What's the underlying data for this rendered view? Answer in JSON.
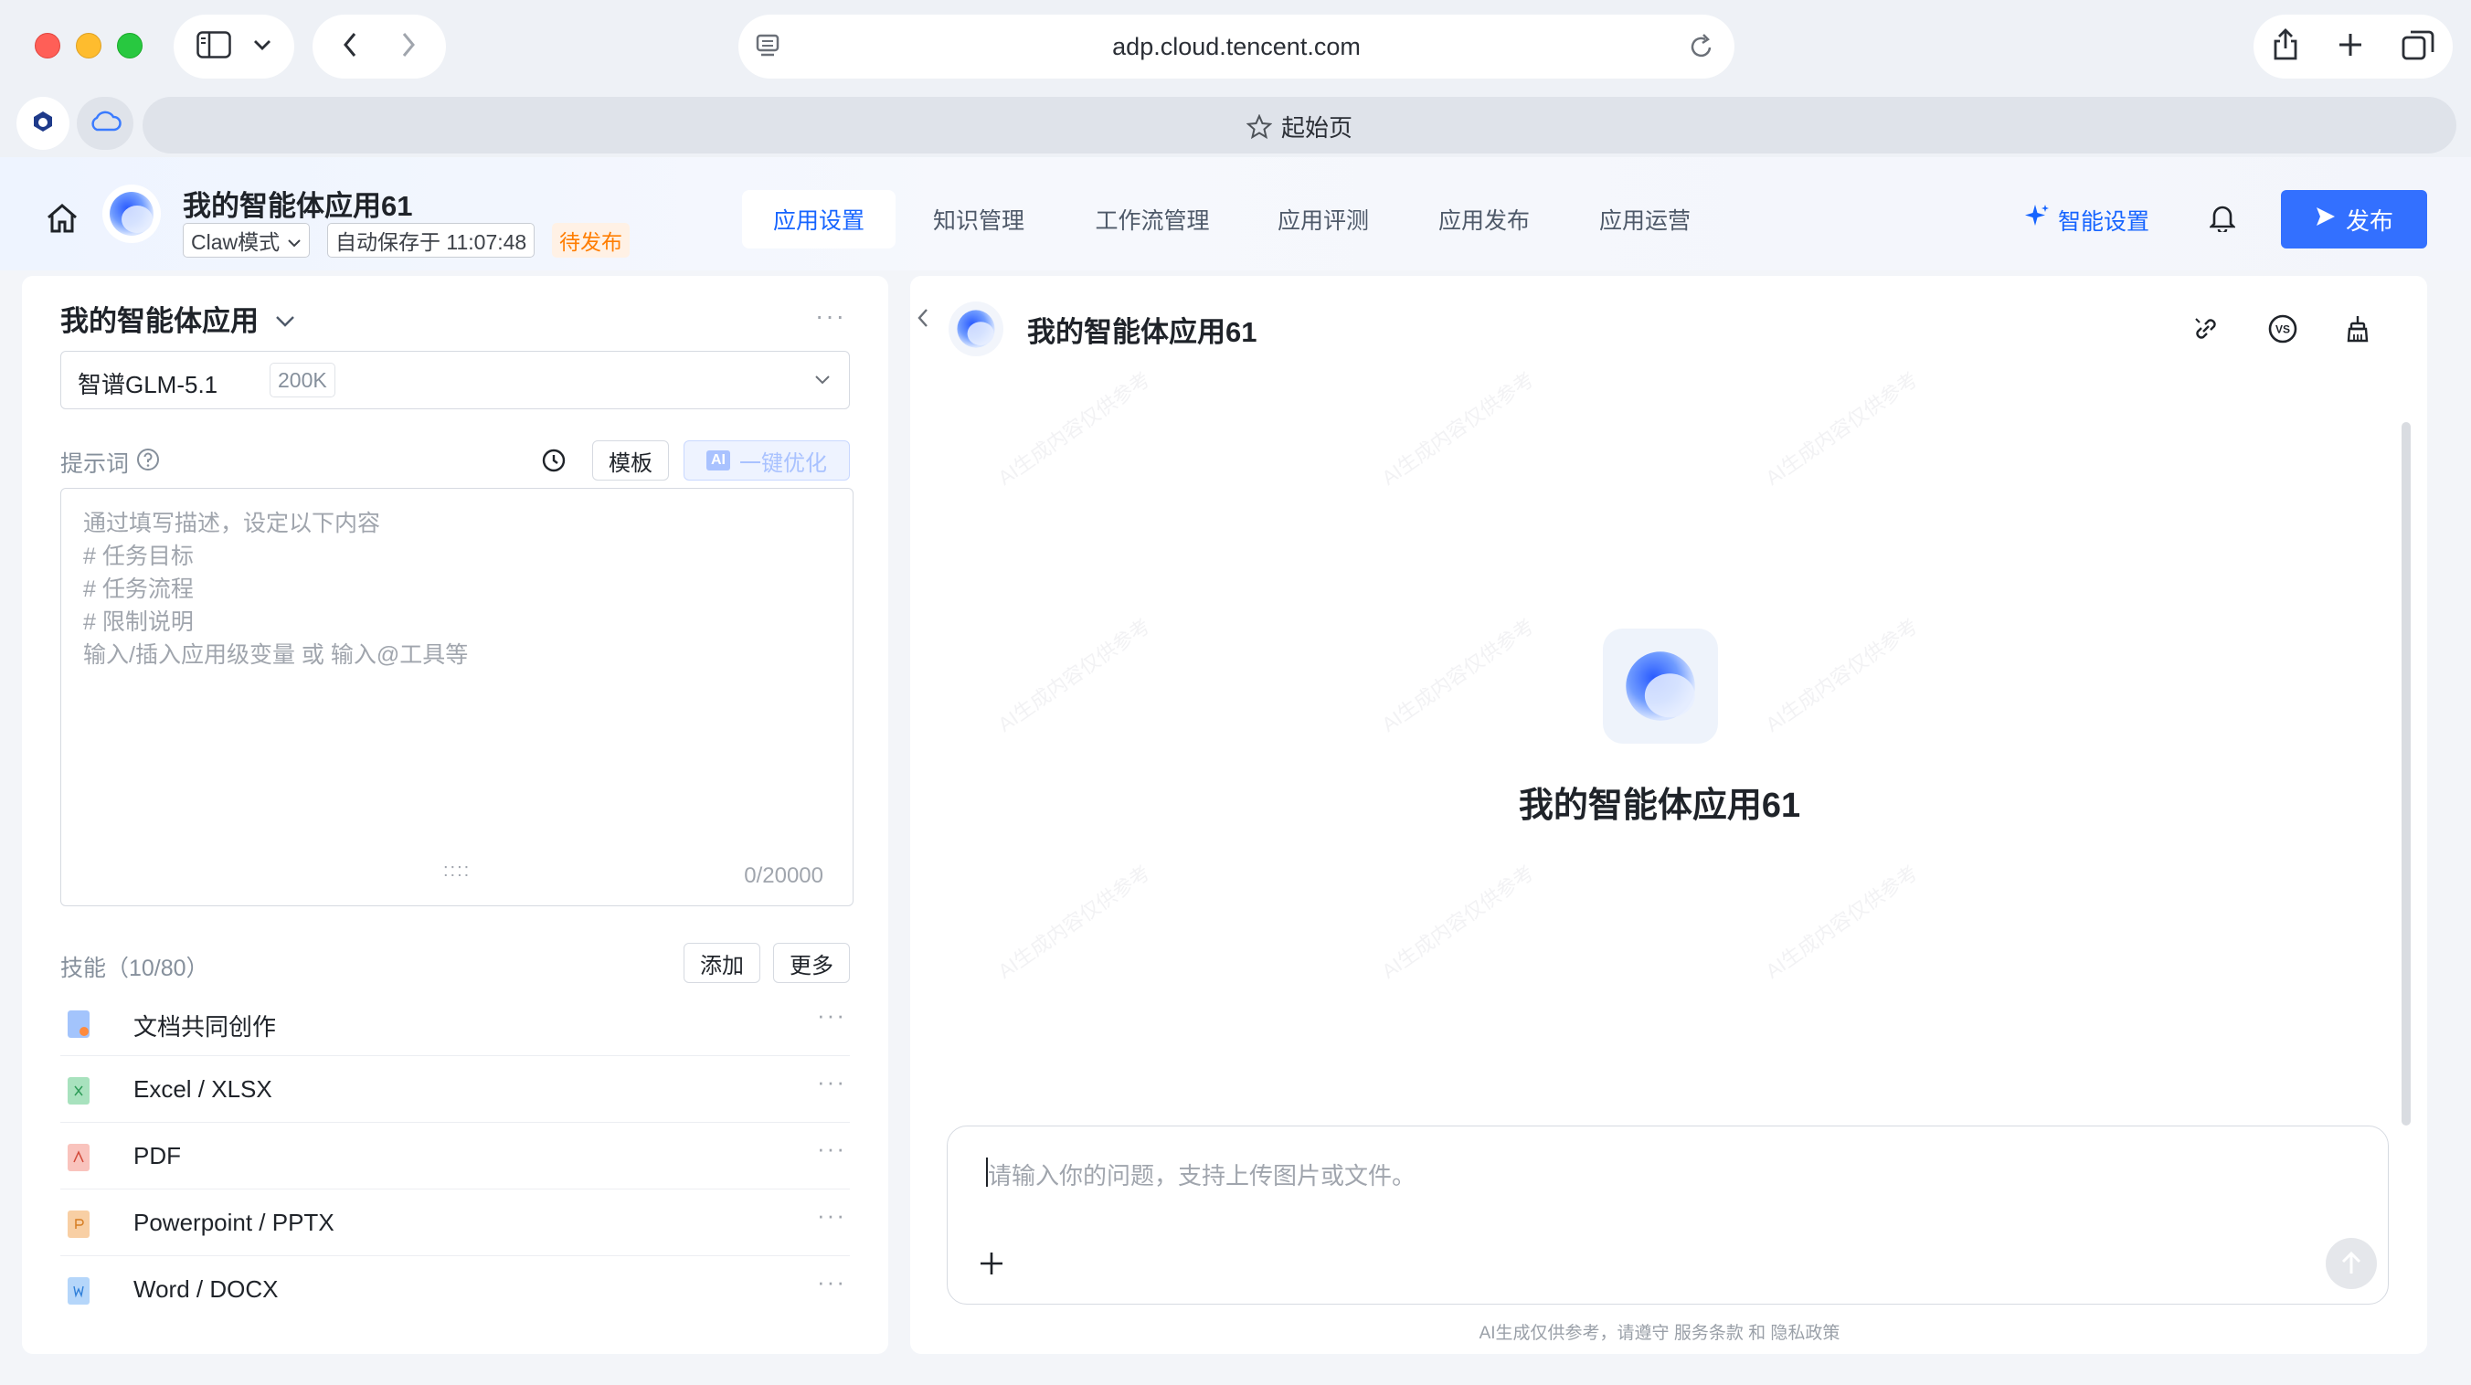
{
  "browser": {
    "url": "adp.cloud.tencent.com",
    "tab_label": "起始页"
  },
  "header": {
    "app_title": "我的智能体应用61",
    "mode_label": "Claw模式",
    "autosave_label": "自动保存于 11:07:48",
    "status_label": "待发布",
    "tabs": [
      "应用设置",
      "知识管理",
      "工作流管理",
      "应用评测",
      "应用发布",
      "应用运营"
    ],
    "active_tab": "应用设置",
    "smart_settings_label": "智能设置",
    "publish_label": "发布"
  },
  "left": {
    "panel_title": "我的智能体应用",
    "model": {
      "name": "智谱GLM-5.1",
      "context": "200K"
    },
    "prompt": {
      "label": "提示词",
      "template_label": "模板",
      "ai_tag": "AI",
      "optimize_label": "一键优化",
      "placeholder_lines": [
        "通过填写描述，设定以下内容",
        "# 任务目标",
        "# 任务流程",
        "# 限制说明",
        "输入/插入应用级变量 或 输入@工具等"
      ],
      "counter": "0/20000"
    },
    "skills": {
      "label": "技能（10/80）",
      "add_label": "添加",
      "more_label": "更多",
      "items": [
        {
          "label": "文档共同创作",
          "color": "#4f8ff7"
        },
        {
          "label": "Excel / XLSX",
          "color": "#3fbf6f"
        },
        {
          "label": "PDF",
          "color": "#f06a5a"
        },
        {
          "label": "Powerpoint / PPTX",
          "color": "#f3a85a"
        },
        {
          "label": "Word / DOCX",
          "color": "#5aa3f5"
        }
      ]
    }
  },
  "right": {
    "chat_title": "我的智能体应用61",
    "center_title": "我的智能体应用61",
    "input_placeholder": "请输入你的问题，支持上传图片或文件。",
    "disclaimer": "AI生成仅供参考，请遵守 服务条款 和 隐私政策"
  },
  "colors": {
    "accent": "#1664ff",
    "publish_bg": "#3370ff",
    "status_orange": "#ff7d00"
  }
}
